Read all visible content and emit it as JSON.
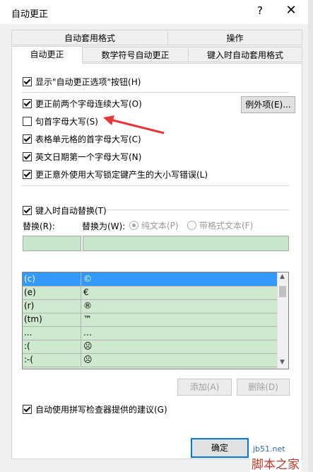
{
  "dialog": {
    "title": "自动更正",
    "help": "?",
    "close": "✕"
  },
  "tabs": {
    "row1": [
      "自动套用格式",
      "操作"
    ],
    "row2": [
      "自动更正",
      "数学符号自动更正",
      "键入时自动套用格式"
    ],
    "active": "自动更正"
  },
  "options": {
    "show_buttons": {
      "label": "显示\"自动更正选项\"按钮(H)",
      "checked": true
    },
    "two_initial_caps": {
      "label": "更正前两个字母连续大写(O)",
      "checked": true
    },
    "sentence_caps": {
      "label": "句首字母大写(S)",
      "checked": false
    },
    "table_cell_caps": {
      "label": "表格单元格的首字母大写(C)",
      "checked": true
    },
    "day_names_caps": {
      "label": "英文日期第一个字母大写(N)",
      "checked": true
    },
    "caps_lock_fix": {
      "label": "更正意外使用大写锁定键产生的大小写错误(L)",
      "checked": true
    },
    "exceptions_button": "例外项(E)..."
  },
  "replace": {
    "enable": {
      "label": "键入时自动替换(T)",
      "checked": true
    },
    "replace_label": "替换(R):",
    "with_label": "替换为(W):",
    "radio_plain": {
      "label": "纯文本(P)",
      "selected": true
    },
    "radio_formatted": {
      "label": "带格式文本(F)",
      "selected": false
    },
    "replace_value": "",
    "with_value": "",
    "entries": [
      {
        "from": "(c)",
        "to": "©",
        "selected": true
      },
      {
        "from": "(e)",
        "to": "€",
        "selected": false
      },
      {
        "from": "(r)",
        "to": "®",
        "selected": false
      },
      {
        "from": "(tm)",
        "to": "™",
        "selected": false
      },
      {
        "from": "...",
        "to": "…",
        "selected": false
      },
      {
        "from": ":(",
        "to": "☹",
        "selected": false
      },
      {
        "from": ":-(",
        "to": "☹",
        "selected": false
      }
    ],
    "add_button": "添加(A)",
    "delete_button": "删除(D)",
    "spellcheck": {
      "label": "自动使用拼写检查器提供的建议(G)",
      "checked": true
    }
  },
  "footer": {
    "ok_button": "确定"
  },
  "watermark": {
    "site": "jb51.net",
    "brand": "脚本之家"
  },
  "colors": {
    "accent": "#0078d7",
    "selection": "#3399ff",
    "list_bg": "#cfe9cf",
    "annotation_arrow": "#e8373a"
  }
}
